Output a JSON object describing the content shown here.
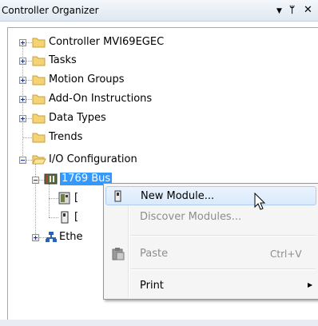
{
  "window": {
    "title": "Controller Organizer",
    "buttons": {
      "dropdown": "▼",
      "pin": "ᛘ",
      "close": "✕"
    }
  },
  "tree": {
    "items": [
      {
        "label": "Controller MVI69EGEC",
        "icon": "folder-icon",
        "expanded": false
      },
      {
        "label": "Tasks",
        "icon": "folder-icon",
        "expanded": false
      },
      {
        "label": "Motion Groups",
        "icon": "folder-icon",
        "expanded": false
      },
      {
        "label": "Add-On Instructions",
        "icon": "folder-icon",
        "expanded": false
      },
      {
        "label": "Data Types",
        "icon": "folder-icon",
        "expanded": false
      },
      {
        "label": "Trends",
        "icon": "folder-icon"
      },
      {
        "label": "I/O Configuration",
        "icon": "open-folder-icon",
        "expanded": true
      },
      {
        "label": "1769 Bus",
        "icon": "backplane-icon",
        "expanded": true,
        "selected": true
      },
      {
        "label": "[",
        "icon": "controller-module-icon"
      },
      {
        "label": "[",
        "icon": "io-module-icon"
      },
      {
        "label": "Ethe",
        "icon": "ethernet-network-icon",
        "expanded": false
      }
    ]
  },
  "context_menu": {
    "items": [
      {
        "label": "New Module...",
        "icon": "module-icon",
        "enabled": true,
        "highlighted": true
      },
      {
        "label": "Discover Modules...",
        "enabled": false
      },
      {
        "label": "Paste",
        "shortcut": "Ctrl+V",
        "icon": "clipboard-icon",
        "enabled": false
      },
      {
        "label": "Print",
        "submenu": true,
        "enabled": true
      }
    ],
    "submenu_arrow": "▶"
  },
  "colors": {
    "selection": "#3399ff",
    "folder": "#f5d372",
    "menu_highlight": "#d9eafc",
    "disabled_text": "#8d8d8d"
  }
}
